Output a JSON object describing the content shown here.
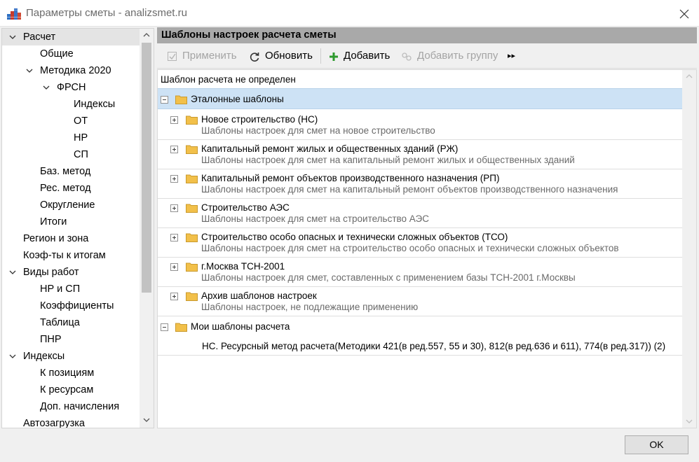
{
  "window": {
    "title": "Параметры сметы - analizsmet.ru"
  },
  "nav": {
    "items": [
      {
        "label": "Расчет",
        "expanded": true,
        "selected": true
      },
      {
        "label": "Общие"
      },
      {
        "label": "Методика 2020",
        "expanded": true
      },
      {
        "label": "ФРСН",
        "expanded": true
      },
      {
        "label": "Индексы"
      },
      {
        "label": "ОТ"
      },
      {
        "label": "НР"
      },
      {
        "label": "СП"
      },
      {
        "label": "Баз. метод"
      },
      {
        "label": "Рес. метод"
      },
      {
        "label": "Округление"
      },
      {
        "label": "Итоги"
      },
      {
        "label": "Регион и зона"
      },
      {
        "label": "Коэф-ты к итогам"
      },
      {
        "label": "Виды работ",
        "expanded": true
      },
      {
        "label": "НР и СП"
      },
      {
        "label": "Коэффициенты"
      },
      {
        "label": "Таблица"
      },
      {
        "label": "ПНР"
      },
      {
        "label": "Индексы",
        "expanded": true
      },
      {
        "label": "К позициям"
      },
      {
        "label": "К ресурсам"
      },
      {
        "label": "Доп. начисления"
      },
      {
        "label": "Автозагрузка"
      }
    ]
  },
  "panel": {
    "header": "Шаблоны настроек расчета сметы",
    "toolbar": {
      "apply_label": "Применить",
      "refresh_label": "Обновить",
      "add_label": "Добавить",
      "add_group_label": "Добавить группу",
      "more_label": "▸▸"
    },
    "status": "Шаблон расчета не определен",
    "reference_group": {
      "title": "Эталонные шаблоны"
    },
    "reference_items": [
      {
        "title": "Новое строительство (НС)",
        "subtitle": "Шаблоны настроек для смет на новое строительство"
      },
      {
        "title": "Капитальный ремонт жилых и общественных зданий (РЖ)",
        "subtitle": "Шаблоны настроек для смет на капитальный ремонт жилых и общественных зданий"
      },
      {
        "title": "Капитальный ремонт объектов производственного назначения (РП)",
        "subtitle": "Шаблоны настроек для смет на капитальный ремонт объектов производственного назначения"
      },
      {
        "title": "Строительство АЭС",
        "subtitle": "Шаблоны настроек для смет на строительство АЭС"
      },
      {
        "title": "Строительство особо опасных и технически сложных объектов (ТСО)",
        "subtitle": "Шаблоны настроек для смет на строительство особо опасных и технически сложных объектов"
      },
      {
        "title": "г.Москва ТСН-2001",
        "subtitle": "Шаблоны настроек для смет, составленных с применением базы ТСН-2001 г.Москвы"
      },
      {
        "title": "Архив шаблонов настроек",
        "subtitle": "Шаблоны настроек, не подлежащие применению"
      }
    ],
    "my_group": {
      "title": "Мои шаблоны расчета"
    },
    "my_items": [
      {
        "title": "НС. Ресурсный метод расчета(Методики 421(в ред.557, 55 и 30), 812(в ред.636 и 611), 774(в ред.317)) (2)"
      }
    ]
  },
  "footer": {
    "ok_label": "OK"
  },
  "colors": {
    "header_bg": "#a9a9a9",
    "group_highlight": "#cde2f5",
    "folder": "#f2c04a",
    "add_icon": "#2e9a2e"
  }
}
